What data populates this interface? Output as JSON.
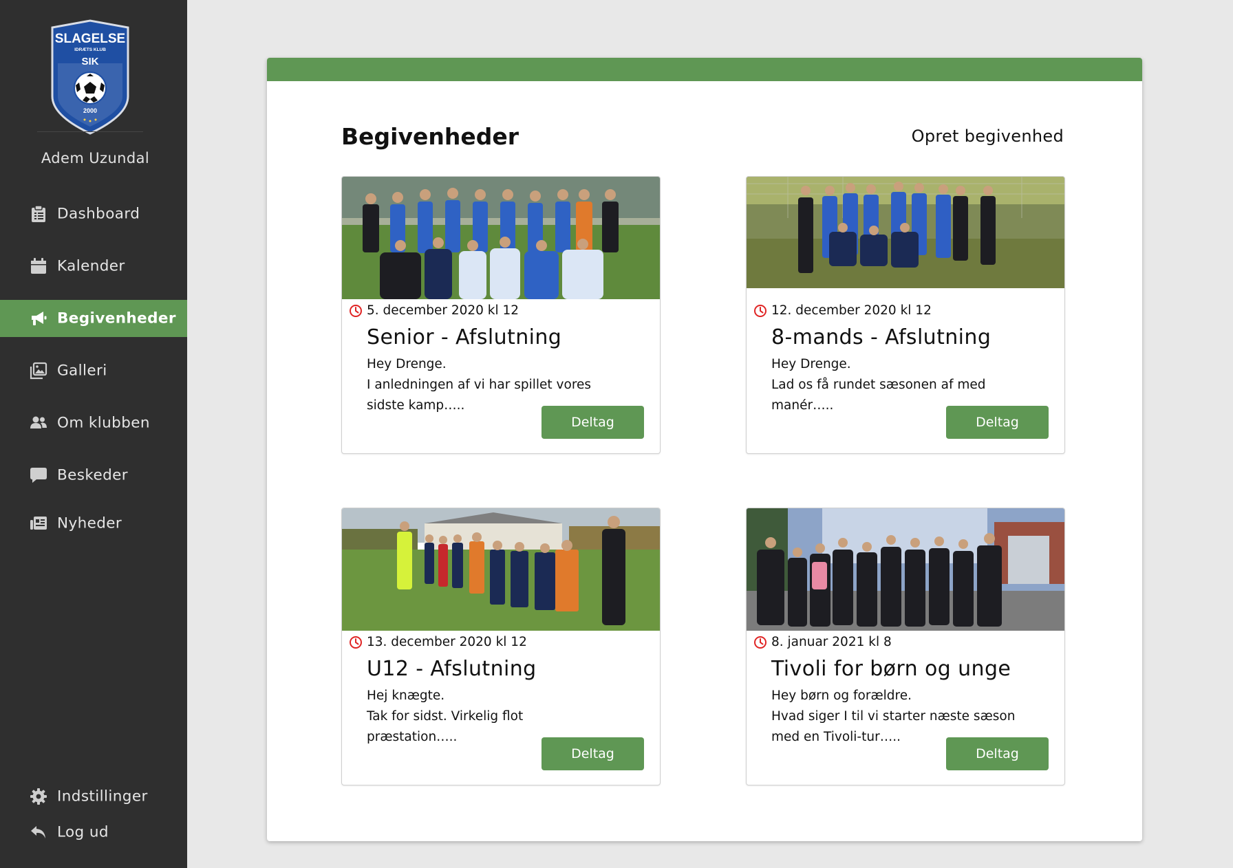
{
  "sidebar": {
    "logo": {
      "club_name": "SLAGELSE",
      "subtitle": "IDRÆTS KLUB",
      "abbr": "SIK",
      "year": "2000"
    },
    "user_name": "Adem Uzundal",
    "items": [
      {
        "label": "Dashboard",
        "icon": "clipboard-icon"
      },
      {
        "label": "Kalender",
        "icon": "calendar-icon"
      },
      {
        "label": "Begivenheder",
        "icon": "megaphone-icon",
        "active": true
      },
      {
        "label": "Galleri",
        "icon": "gallery-icon"
      },
      {
        "label": "Om klubben",
        "icon": "users-icon"
      },
      {
        "label": "Beskeder",
        "icon": "chat-icon"
      },
      {
        "label": "Nyheder",
        "icon": "newspaper-icon"
      }
    ],
    "footer": [
      {
        "label": "Indstillinger",
        "icon": "gear-icon"
      },
      {
        "label": "Log ud",
        "icon": "logout-icon"
      }
    ]
  },
  "main": {
    "title": "Begivenheder",
    "create_label": "Opret begivenhed",
    "events": [
      {
        "date": "5. december 2020 kl 12",
        "title": "Senior - Afslutning",
        "lines": [
          "Hey Drenge.",
          "I anledningen af vi har spillet vores",
          "sidste kamp….."
        ],
        "button": "Deltag"
      },
      {
        "date": "12. december 2020 kl 12",
        "title": "8-mands - Afslutning",
        "lines": [
          "Hey Drenge.",
          "Lad os få rundet sæsonen af med",
          "manér….."
        ],
        "button": "Deltag"
      },
      {
        "date": "13. december 2020 kl 12",
        "title": "U12 - Afslutning",
        "lines": [
          "Hej knægte.",
          "Tak for sidst. Virkelig flot",
          "præstation….."
        ],
        "button": "Deltag"
      },
      {
        "date": "8. januar 2021 kl 8",
        "title": "Tivoli for børn og unge",
        "lines": [
          "Hey børn og forældre.",
          "Hvad siger I til vi starter næste sæson",
          "med en Tivoli-tur….."
        ],
        "button": "Deltag"
      }
    ]
  },
  "colors": {
    "sidebar_bg": "#2f2f2f",
    "accent_green": "#5f9754",
    "page_bg": "#e8e8e8",
    "clock_red": "#e02424",
    "logo_blue": "#1f4fa3"
  }
}
